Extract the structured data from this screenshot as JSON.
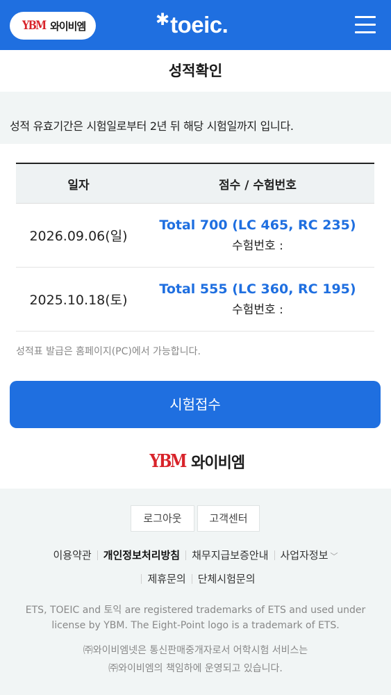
{
  "header": {
    "ybm_mark": "YBM",
    "ybm_text": "와이비엠",
    "toeic_logo": "toeic.",
    "menu_icon": "hamburger-menu-icon"
  },
  "page": {
    "title": "성적확인",
    "notice": "성적 유효기간은 시험일로부터 2년 뒤 해당 시험일까지 입니다."
  },
  "table": {
    "headers": [
      "일자",
      "점수 / 수험번호"
    ],
    "rows": [
      {
        "date": "2026.09.06(일)",
        "total": "Total 700 (LC 465, RC 235)",
        "exam_no": "수험번호 :"
      },
      {
        "date": "2025.10.18(토)",
        "total": "Total 555 (LC 360, RC 195)",
        "exam_no": "수험번호 :"
      }
    ]
  },
  "issue_note": "성적표 발급은 홈페이지(PC)에서 가능합니다.",
  "apply_button": "시험접수",
  "footer": {
    "logo_mark": "YBM",
    "logo_text": "와이비엠",
    "logout": "로그아웃",
    "support": "고객센터",
    "links_row1": [
      "이용약관",
      "개인정보처리방침",
      "채무지급보증안내",
      "사업자정보"
    ],
    "links_row2": [
      "제휴문의",
      "단체시험문의"
    ],
    "trademark_1": "ETS, TOEIC and 토익 are registered trademarks of ETS and used under",
    "trademark_2": "license by YBM. The Eight-Point logo is a trademark of ETS.",
    "company_1": "㈜와이비엠넷은 통신판매중개자로서 어학시험 서비스는",
    "company_2": "㈜와이비엠의 책임하에 운영되고 있습니다."
  },
  "colors": {
    "brand_blue": "#1f6fe0",
    "ybm_red": "#d8232a",
    "band_gray": "#f1f5f5"
  }
}
